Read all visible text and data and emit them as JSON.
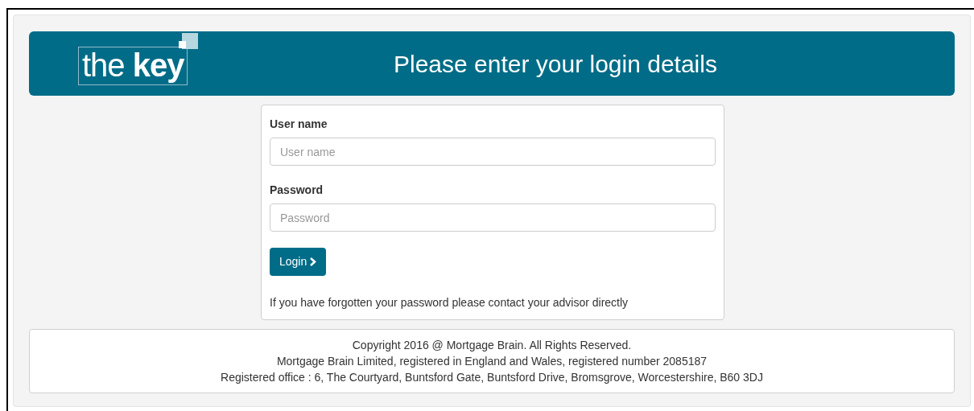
{
  "header": {
    "logo": "the **key**",
    "title": "Please enter your login details"
  },
  "form": {
    "fields": [
      {
        "label": "User name",
        "placeholder": "User name"
      },
      {
        "label": "Password",
        "placeholder": "Password"
      }
    ],
    "button": "Login",
    "help": "If you have forgotten your password please contact your advisor directly"
  },
  "footer": [
    "Copyright 2016 @ Mortgage Brain. All Rights Reserved.",
    "Mortgage Brain Limited, registered in England and Wales, registered number 2085187",
    "Registered office : 6, The Courtyard, Buntsford Gate, Buntsford Drive, Bromsgrove, Worcestershire, B60 3DJ"
  ]
}
